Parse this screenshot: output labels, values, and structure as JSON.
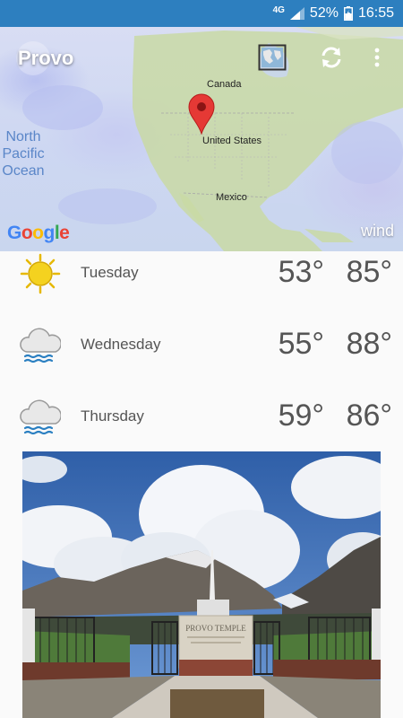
{
  "status_bar": {
    "network": "4G",
    "battery": "52%",
    "time": "16:55"
  },
  "map": {
    "city": "Provo",
    "labels": {
      "canada": "Canada",
      "united_states": "United States",
      "mexico": "Mexico",
      "ocean_line1": "North",
      "ocean_line2": "Pacific",
      "ocean_line3": "Ocean"
    },
    "layer": "wind",
    "attribution": "Google"
  },
  "forecast": [
    {
      "day": "Tuesday",
      "low": "53°",
      "high": "85°",
      "icon": "sun-icon"
    },
    {
      "day": "Wednesday",
      "low": "55°",
      "high": "88°",
      "icon": "rain-cloud-icon"
    },
    {
      "day": "Thursday",
      "low": "59°",
      "high": "86°",
      "icon": "rain-cloud-icon"
    }
  ],
  "photo": {
    "sign_line1": "PROVO TEMPLE"
  }
}
